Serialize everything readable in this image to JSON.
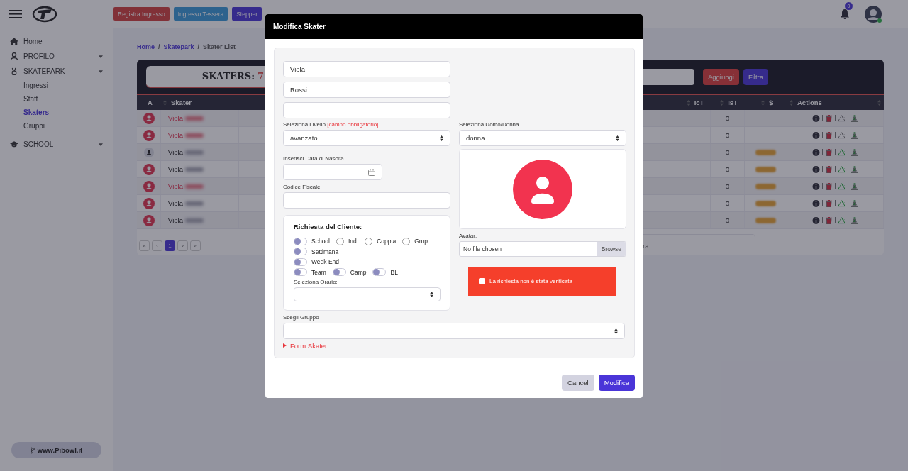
{
  "header": {
    "buttons": [
      {
        "label": "Registra Ingresso",
        "kind": "danger"
      },
      {
        "label": "Ingresso Tessera",
        "kind": "info"
      },
      {
        "label": "Stepper",
        "kind": "primary"
      }
    ],
    "notification_count": "0"
  },
  "sidebar": {
    "items": [
      {
        "label": "Home",
        "expandable": false
      },
      {
        "label": "PROFILO",
        "expandable": true
      },
      {
        "label": "SKATEPARK",
        "expandable": true,
        "children": [
          {
            "label": "Ingressi",
            "selected": false
          },
          {
            "label": "Staff",
            "selected": false
          },
          {
            "label": "Skaters",
            "selected": true
          },
          {
            "label": "Gruppi",
            "selected": false
          }
        ]
      },
      {
        "label": "SCHOOL",
        "expandable": true
      }
    ],
    "footer_link": "www.Pibowl.it"
  },
  "breadcrumb": {
    "items": [
      {
        "label": "Home",
        "link": true
      },
      {
        "label": "Skatepark",
        "link": true
      },
      {
        "label": "Skater List",
        "link": false
      }
    ],
    "separators": [
      "/",
      "/"
    ]
  },
  "table": {
    "count_label": "SKATERS:",
    "count": "7",
    "buttons": [
      {
        "label": "Aggiungi",
        "kind": "danger"
      },
      {
        "label": "Filtra",
        "kind": "primary"
      }
    ],
    "columns": [
      "A",
      "Skater",
      "IcT",
      "IsT",
      "$",
      "Actions"
    ],
    "rows": [
      {
        "name": "Viola",
        "flagged": true,
        "avatar_active": true,
        "ist": "0",
        "paid": false,
        "renewable": false
      },
      {
        "name": "Viola",
        "flagged": true,
        "avatar_active": true,
        "ist": "0",
        "paid": false,
        "renewable": false
      },
      {
        "name": "Viola",
        "flagged": false,
        "avatar_active": false,
        "ist": "0",
        "paid": true,
        "renewable": true
      },
      {
        "name": "Viola",
        "flagged": false,
        "avatar_active": true,
        "ist": "0",
        "paid": true,
        "renewable": true
      },
      {
        "name": "Viola",
        "flagged": true,
        "avatar_active": true,
        "ist": "0",
        "paid": true,
        "renewable": true
      },
      {
        "name": "Viola",
        "flagged": false,
        "avatar_active": true,
        "ist": "0",
        "paid": true,
        "renewable": true
      },
      {
        "name": "Viola",
        "flagged": false,
        "avatar_active": true,
        "ist": "0",
        "paid": true,
        "renewable": true
      }
    ],
    "pagination": [
      {
        "label": "«",
        "selected": false
      },
      {
        "label": "‹",
        "selected": false
      },
      {
        "label": "1",
        "selected": true
      },
      {
        "label": "›",
        "selected": false
      },
      {
        "label": "»",
        "selected": false
      }
    ],
    "partial_text": "ra"
  },
  "modal": {
    "title": "Modifica Skater",
    "first_name": "Viola",
    "last_name": "Rossi",
    "level": {
      "label": "Seleziona Livello",
      "required_note": "[campo obbligatorio]",
      "value": "avanzato"
    },
    "gender": {
      "label": "Seleziona Uomo/Donna",
      "value": "donna"
    },
    "birth_date": {
      "label": "Inserisci Data di Nascita"
    },
    "tax_code": {
      "label": "Codice Fiscale"
    },
    "request": {
      "title": "Richiesta del Cliente:",
      "option_rows": [
        [
          {
            "label": "School",
            "kind": "switch",
            "on": false
          },
          {
            "label": "Ind.",
            "kind": "checkbox",
            "on": false
          },
          {
            "label": "Coppia",
            "kind": "checkbox",
            "on": false
          },
          {
            "label": "Grup",
            "kind": "checkbox",
            "on": false
          }
        ],
        [
          {
            "label": "Settimana",
            "kind": "switch",
            "on": false
          }
        ],
        [
          {
            "label": "Week End",
            "kind": "switch",
            "on": false
          }
        ],
        [
          {
            "label": "Team",
            "kind": "switch",
            "on": false
          },
          {
            "label": "Camp",
            "kind": "switch",
            "on": false
          },
          {
            "label": "BL",
            "kind": "switch",
            "on": false
          }
        ]
      ],
      "schedule_label": "Seleziona Orario:"
    },
    "avatar": {
      "label": "Avatar:",
      "file_text": "No file chosen",
      "browse": "Browse"
    },
    "verification": {
      "label": "La richiesta non è stata verificata",
      "checked": false
    },
    "group": {
      "label": "Scegli Gruppo"
    },
    "form_toggle": {
      "label": "Form Skater",
      "expanded": false
    },
    "buttons": [
      {
        "label": "Cancel",
        "kind": "secondary"
      },
      {
        "label": "Modifica",
        "kind": "primary"
      }
    ]
  }
}
